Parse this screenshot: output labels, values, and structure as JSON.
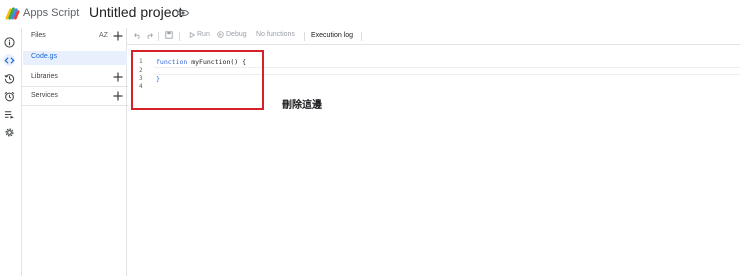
{
  "header": {
    "app_name": "Apps Script",
    "project_title": "Untitled project"
  },
  "sidebar": {
    "files_label": "Files",
    "sort_label": "AZ",
    "files": [
      "Code.gs"
    ],
    "libraries_label": "Libraries",
    "services_label": "Services"
  },
  "toolbar": {
    "run_label": "Run",
    "debug_label": "Debug",
    "function_select": "No functions",
    "execution_log_label": "Execution log"
  },
  "editor": {
    "line_numbers": [
      "1",
      "2",
      "3",
      "4"
    ],
    "line1_keyword": "function",
    "line1_rest": " myFunction() {",
    "line3": "}"
  },
  "annotation": {
    "text": "刪除這邊",
    "box_color": "#d6202a"
  }
}
